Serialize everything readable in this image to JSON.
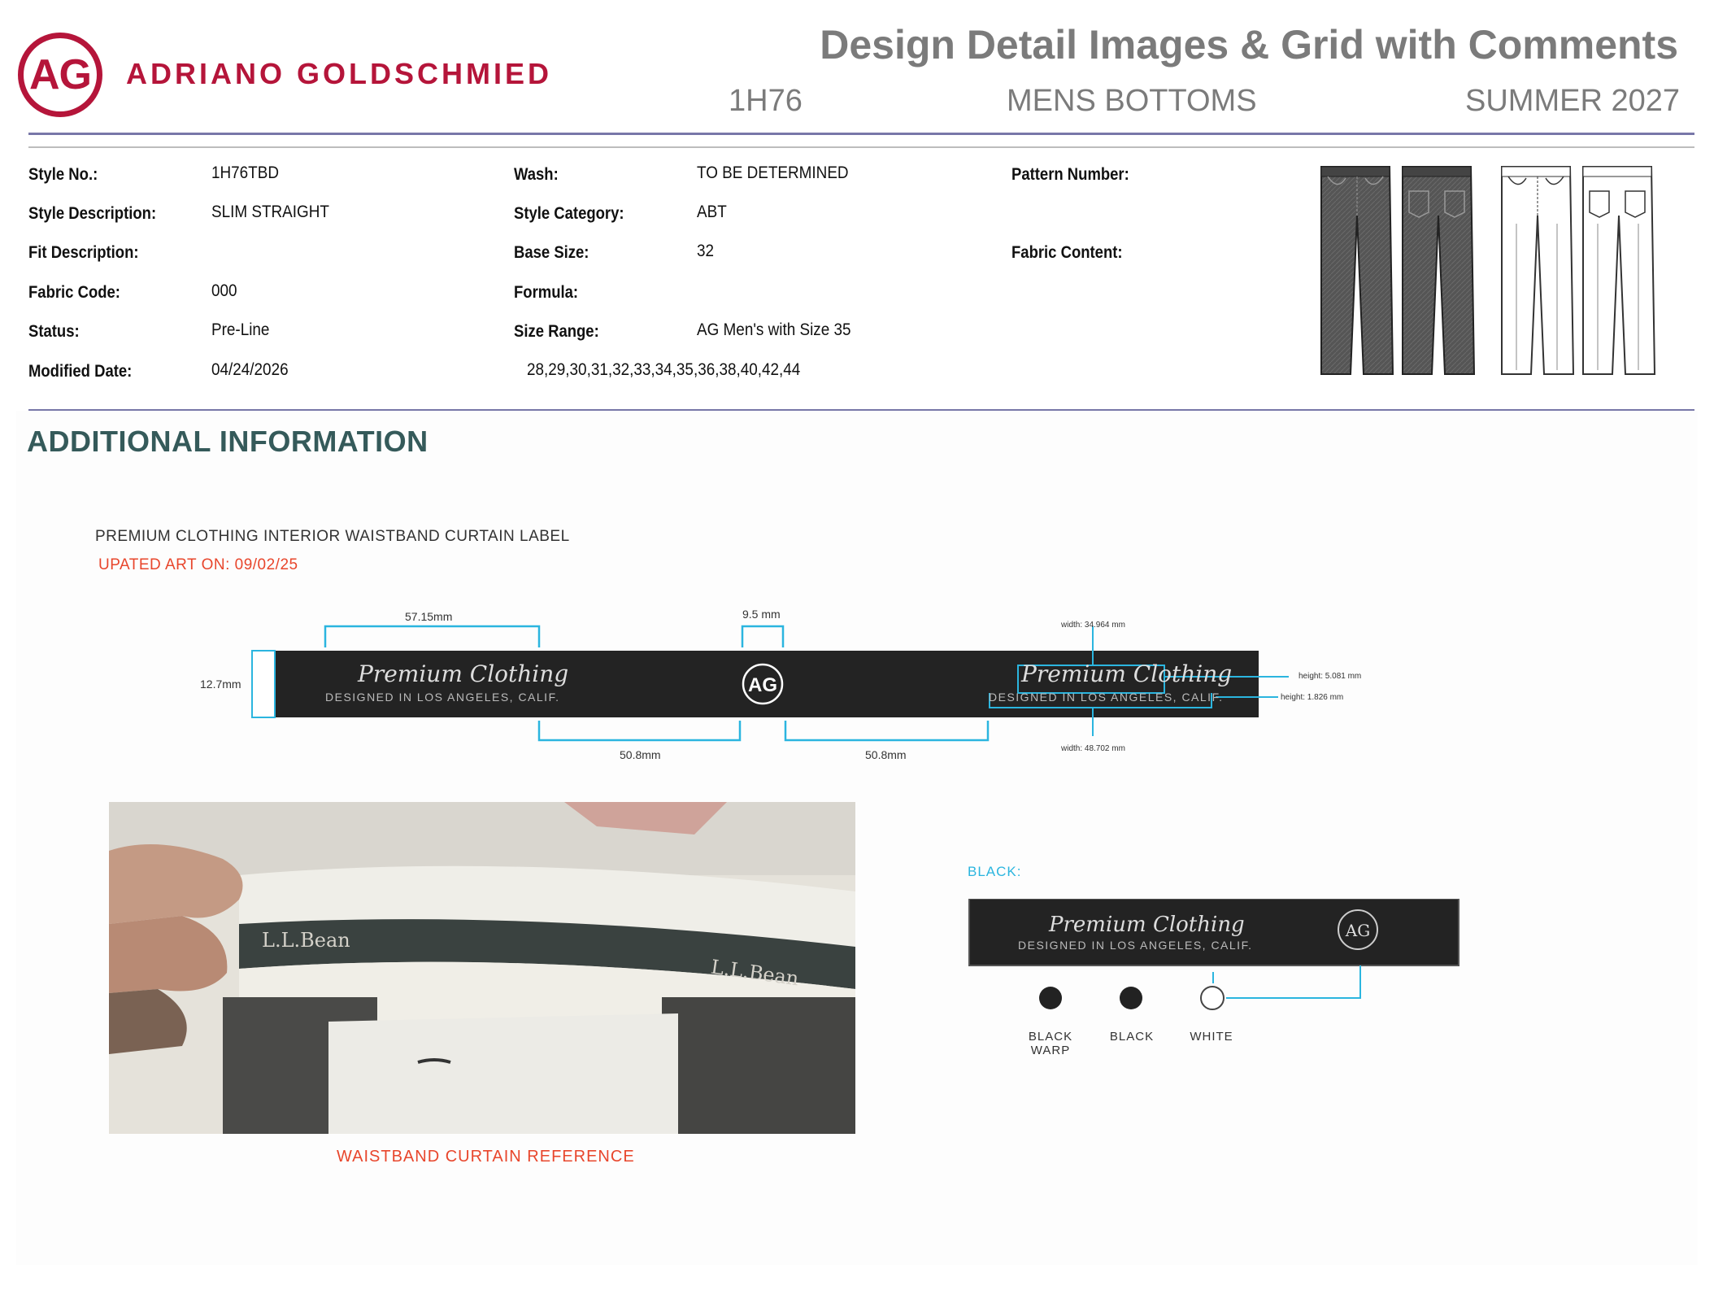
{
  "header": {
    "logo_text": "AG",
    "brand": "ADRIANO GOLDSCHMIED",
    "title": "Design Detail Images & Grid with Comments",
    "style_code": "1H76",
    "category": "MENS BOTTOMS",
    "season": "SUMMER 2027"
  },
  "info": {
    "col1": [
      {
        "label": "Style No.:",
        "value": "1H76TBD"
      },
      {
        "label": "Style Description:",
        "value": "SLIM STRAIGHT"
      },
      {
        "label": "Fit Description:",
        "value": ""
      },
      {
        "label": "Fabric Code:",
        "value": "000"
      },
      {
        "label": "Status:",
        "value": "Pre-Line"
      },
      {
        "label": "Modified Date:",
        "value": "04/24/2026"
      }
    ],
    "col2": [
      {
        "label": "Wash:",
        "value": "TO BE DETERMINED"
      },
      {
        "label": "Style Category:",
        "value": "ABT"
      },
      {
        "label": "Base Size:",
        "value": "32"
      },
      {
        "label": "Formula:",
        "value": ""
      },
      {
        "label": "Size Range:",
        "value": "AG Men's with Size 35"
      }
    ],
    "size_list": "28,29,30,31,32,33,34,35,36,38,40,42,44",
    "col3": [
      {
        "label": "Pattern Number:",
        "value": ""
      },
      {
        "label": "Fabric Content:",
        "value": ""
      }
    ]
  },
  "additional": {
    "heading": "ADDITIONAL INFORMATION",
    "label_title": "PREMIUM CLOTHING INTERIOR WAISTBAND CURTAIN LABEL",
    "updated": "UPATED ART ON: 09/02/25",
    "label_script": "Premium Clothing",
    "label_sub": "DESIGNED IN LOS ANGELES, CALIF.",
    "label_logo": "AG",
    "dims": {
      "d1": "57.15mm",
      "d2": "9.5 mm",
      "d3": "12.7mm",
      "d4": "50.8mm",
      "d5": "50.8mm",
      "w1": "width: 34.964 mm",
      "w2": "width: 48.702 mm",
      "h1": "height: 5.081 mm",
      "h2": "height: 1.826 mm"
    },
    "photo_brand": "L.L.Bean",
    "photo_caption": "WAISTBAND CURTAIN REFERENCE",
    "black_title": "BLACK:",
    "swatches": [
      {
        "label": "BLACK WARP",
        "color": "#222222"
      },
      {
        "label": "BLACK",
        "color": "#222222"
      },
      {
        "label": "WHITE",
        "color": "#ffffff"
      }
    ]
  }
}
